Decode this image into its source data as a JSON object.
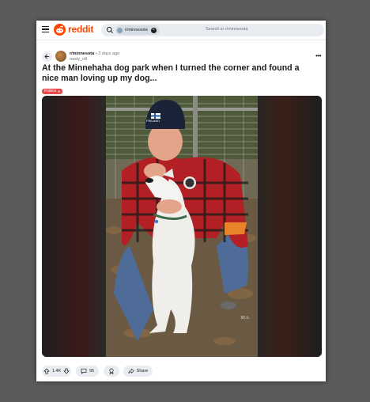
{
  "brand": {
    "name": "reddit",
    "accent": "#ff4500"
  },
  "search": {
    "chip_label": "r/minnesota",
    "placeholder": "Search in r/minnesota"
  },
  "post": {
    "subreddit": "r/minnesota",
    "time_ago": "3 days ago",
    "author": "nasty_n8",
    "title": "At the Minnehaha dog park when I turned the corner and found a nice man loving up my dog...",
    "flair": "Politics",
    "image_hat_text": "FINLAND",
    "image_watermark": "W.s.",
    "votes": "1.4K",
    "comments": "95",
    "share_label": "Share"
  }
}
